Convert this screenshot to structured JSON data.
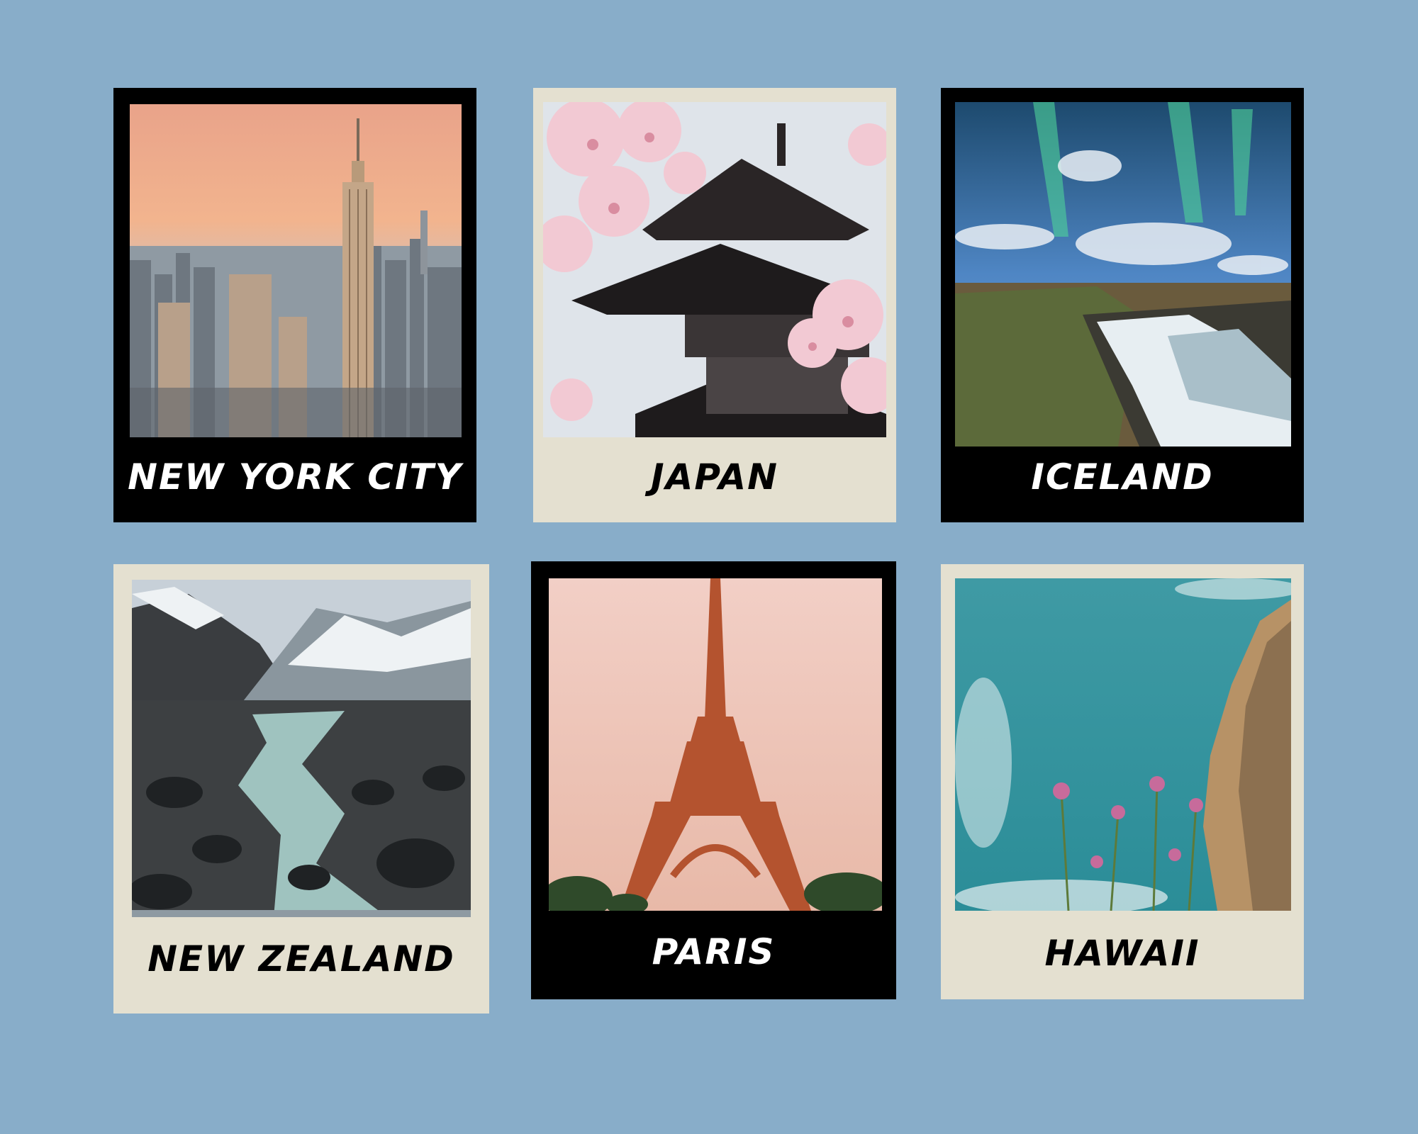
{
  "background_color": "#88adc9",
  "cards": [
    {
      "caption": "New york city",
      "frame": "dark",
      "photo": "new-york-skyline-photo"
    },
    {
      "caption": "JAPAN",
      "frame": "light",
      "photo": "japan-pagoda-cherry-blossom-photo"
    },
    {
      "caption": "ICELAND",
      "frame": "dark",
      "photo": "iceland-aurora-waterfall-photo"
    },
    {
      "caption": "NEW ZEALAND",
      "frame": "light",
      "photo": "new-zealand-mountain-river-photo"
    },
    {
      "caption": "PARIS",
      "frame": "dark",
      "photo": "paris-eiffel-tower-photo"
    },
    {
      "caption": "HAWAII",
      "frame": "light",
      "photo": "hawaii-coast-flowers-photo"
    }
  ],
  "colors": {
    "dark_frame": "#000000",
    "light_frame": "#e4e0d0"
  }
}
